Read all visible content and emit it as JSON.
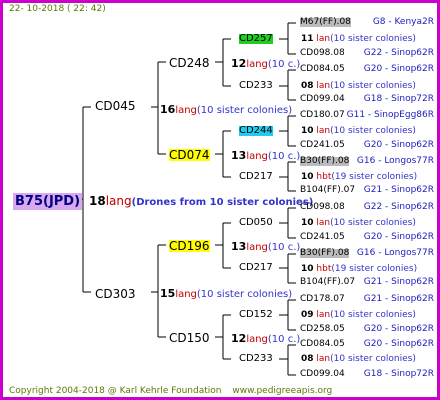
{
  "header": {
    "date": "22- 10-2018 ( 22: 42)"
  },
  "footer": {
    "copyright": "Copyright 2004-2018 @ Karl Kehrle Foundation",
    "site": "www.pedigreeapis.org"
  },
  "root": {
    "id": "B75(JPD)",
    "num": "18",
    "lang": "lang",
    "drones": "(Drones from 10 sister colonies)"
  },
  "g1": [
    {
      "id": "CD045",
      "num": "16",
      "lang": "lang",
      "cnt": "(10 sister colonies)"
    },
    {
      "id": "CD303",
      "num": "15",
      "lang": "lang",
      "cnt": "(10 sister colonies)"
    }
  ],
  "g2": [
    {
      "id": "CD248",
      "num": "12",
      "lang": "lang",
      "cnt": "(10 c.)"
    },
    {
      "id": "CD074",
      "num": "13",
      "lang": "lang",
      "cnt": "(10 c.)"
    },
    {
      "id": "CD196",
      "num": "13",
      "lang": "lang",
      "cnt": "(10 c.)"
    },
    {
      "id": "CD150",
      "num": "12",
      "lang": "lang",
      "cnt": "(10 c.)"
    }
  ],
  "g3": [
    {
      "id": "CD257",
      "num": "11",
      "lang": "lan",
      "cnt": "(10 sister colonies)"
    },
    {
      "id": "CD233",
      "num": "08",
      "lang": "lan",
      "cnt": "(10 sister colonies)"
    },
    {
      "id": "CD244",
      "num": "10",
      "lang": "lan",
      "cnt": "(10 sister colonies)"
    },
    {
      "id": "CD217",
      "num": "10",
      "lang": "hbt",
      "cnt": "(19 sister colonies)"
    },
    {
      "id": "CD050",
      "num": "10",
      "lang": "lan",
      "cnt": "(10 sister colonies)"
    },
    {
      "id": "CD217",
      "num": "10",
      "lang": "hbt",
      "cnt": "(19 sister colonies)"
    },
    {
      "id": "CD152",
      "num": "09",
      "lang": "lan",
      "cnt": "(10 sister colonies)"
    },
    {
      "id": "CD233",
      "num": "08",
      "lang": "lan",
      "cnt": "(10 sister colonies)"
    }
  ],
  "g4": [
    {
      "id": "M67(FF).08",
      "ref": "G8 - Kenya2R"
    },
    {
      "id": "CD098.08",
      "ref": "G22 - Sinop62R"
    },
    {
      "id": "CD084.05",
      "ref": "G20 - Sinop62R"
    },
    {
      "id": "CD099.04",
      "ref": "G18 - Sinop72R"
    },
    {
      "id": "CD180.07",
      "ref": "G11 - SinopEgg86R"
    },
    {
      "id": "CD241.05",
      "ref": "G20 - Sinop62R"
    },
    {
      "id": "B30(FF).08",
      "ref": "G16 - Longos77R"
    },
    {
      "id": "B104(FF).07",
      "ref": "G21 - Sinop62R"
    },
    {
      "id": "CD098.08",
      "ref": "G22 - Sinop62R"
    },
    {
      "id": "CD241.05",
      "ref": "G20 - Sinop62R"
    },
    {
      "id": "B30(FF).08",
      "ref": "G16 - Longos77R"
    },
    {
      "id": "B104(FF).07",
      "ref": "G21 - Sinop62R"
    },
    {
      "id": "CD178.07",
      "ref": "G21 - Sinop62R"
    },
    {
      "id": "CD258.05",
      "ref": "G20 - Sinop62R"
    },
    {
      "id": "CD084.05",
      "ref": "G20 - Sinop62R"
    },
    {
      "id": "CD099.04",
      "ref": "G18 - Sinop72R"
    }
  ]
}
